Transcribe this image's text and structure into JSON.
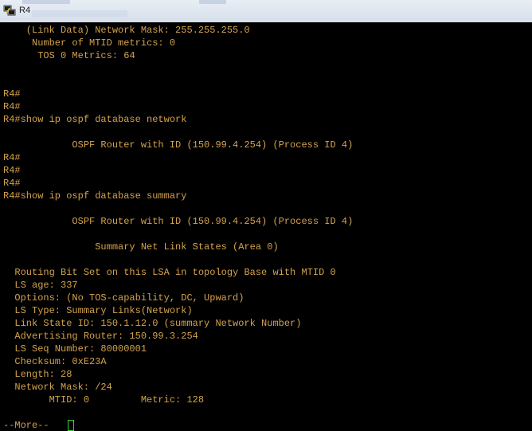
{
  "window": {
    "title": "R4",
    "icon": "putty-terminal-icon"
  },
  "colors": {
    "terminal_bg": "#000000",
    "terminal_fg": "#d4a24c",
    "cursor": "#31d631"
  },
  "terminal": {
    "lines": [
      "    (Link Data) Network Mask: 255.255.255.0",
      "     Number of MTID metrics: 0",
      "      TOS 0 Metrics: 64",
      "",
      "",
      "R4#",
      "R4#",
      "R4#show ip ospf database network",
      "",
      "            OSPF Router with ID (150.99.4.254) (Process ID 4)",
      "R4#",
      "R4#",
      "R4#",
      "R4#show ip ospf database summary",
      "",
      "            OSPF Router with ID (150.99.4.254) (Process ID 4)",
      "",
      "                Summary Net Link States (Area 0)",
      "",
      "  Routing Bit Set on this LSA in topology Base with MTID 0",
      "  LS age: 337",
      "  Options: (No TOS-capability, DC, Upward)",
      "  LS Type: Summary Links(Network)",
      "  Link State ID: 150.1.12.0 (summary Network Number)",
      "  Advertising Router: 150.99.3.254",
      "  LS Seq Number: 80000001",
      "  Checksum: 0xE23A",
      "  Length: 28",
      "  Network Mask: /24",
      "        MTID: 0         Metric: 128",
      "",
      "--More-- "
    ]
  }
}
